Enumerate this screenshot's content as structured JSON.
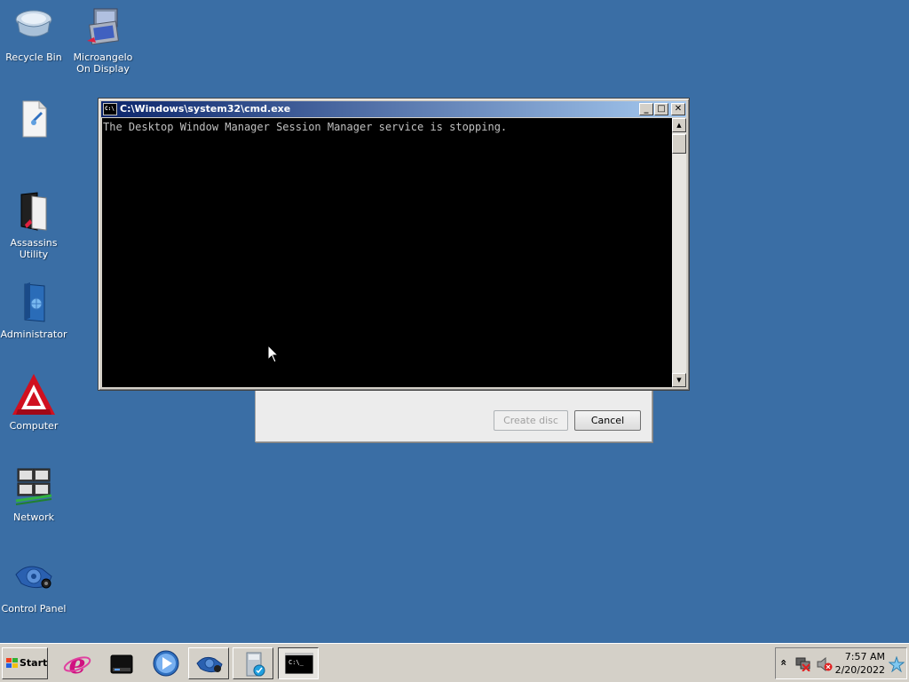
{
  "desktop": {
    "icons": [
      {
        "label": "Recycle Bin"
      },
      {
        "label": "Microangelo On Display"
      },
      {
        "label": ""
      },
      {
        "label": "Assassins Utility"
      },
      {
        "label": "Administrator"
      },
      {
        "label": "Computer"
      },
      {
        "label": "Network"
      },
      {
        "label": "Control Panel"
      }
    ]
  },
  "cmd_window": {
    "title": "C:\\Windows\\system32\\cmd.exe",
    "icon_text": "C:\\",
    "console_text": "The Desktop Window Manager Session Manager service is stopping.",
    "minimize_glyph": "_",
    "maximize_glyph": "□",
    "close_glyph": "✕",
    "scroll_up_glyph": "▲",
    "scroll_down_glyph": "▼"
  },
  "background_dialog": {
    "create_disc_label": "Create disc",
    "cancel_label": "Cancel"
  },
  "taskbar": {
    "start_label": "Start",
    "cmd_icon_text": "C:\\_",
    "tray_expand_glyph": "«",
    "clock_time": "7:57 AM",
    "clock_date": "2/20/2022"
  },
  "colors": {
    "desktop_bg": "#3a6ea5",
    "titlebar_start": "#0a246a",
    "titlebar_end": "#a6caf0",
    "console_bg": "#000000",
    "console_fg": "#c0c0c0"
  }
}
